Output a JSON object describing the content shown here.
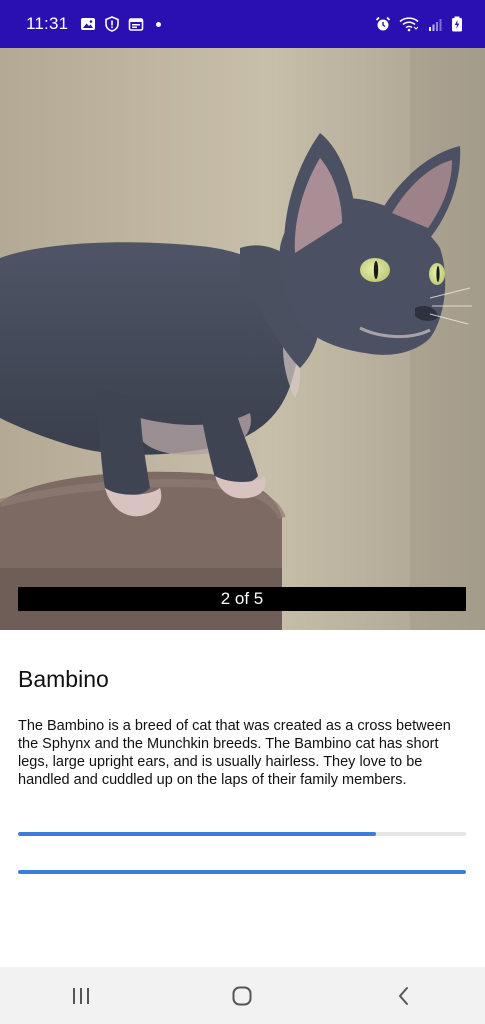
{
  "status_bar": {
    "time": "11:31",
    "left_icons": [
      "gallery-icon",
      "shield-icon",
      "calendar-icon",
      "dot-icon"
    ],
    "right_icons": [
      "alarm-icon",
      "wifi-icon",
      "signal-icon",
      "battery-icon"
    ],
    "background_color": "#2a0fb1"
  },
  "gallery": {
    "counter": "2 of 5"
  },
  "breed": {
    "name": "Bambino",
    "description": "The Bambino is a breed of cat that was created as a cross between the Sphynx and the Munchkin breeds. The Bambino cat has short legs, large upright ears, and is usually hairless. They love to be handled and cuddled up on the laps of their family members."
  },
  "progress": {
    "first_fraction": 0.8,
    "second_fraction": 1.0,
    "color": "#3b7ddb"
  },
  "nav_bar": {
    "buttons": [
      "recent-apps-icon",
      "home-icon",
      "back-icon"
    ]
  }
}
